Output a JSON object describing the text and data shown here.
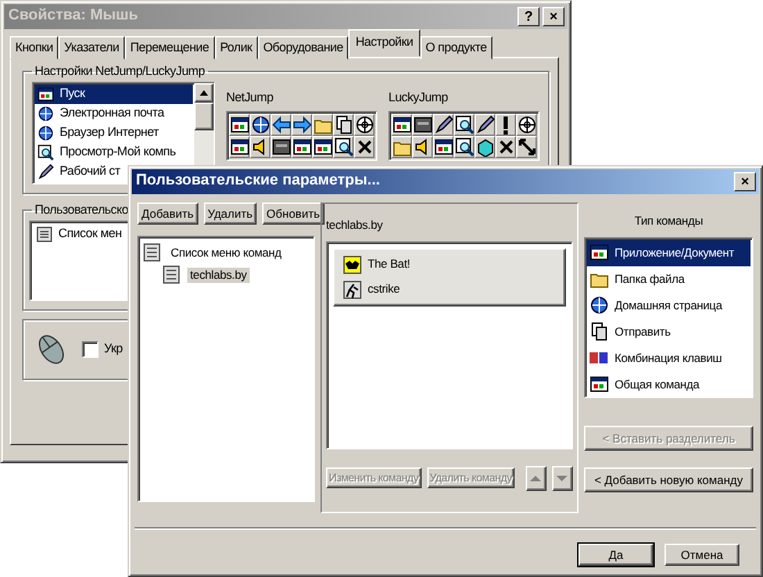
{
  "back_window": {
    "title": "Свойства: Мышь",
    "title_buttons": [
      "?",
      "×"
    ],
    "tabs": [
      {
        "label": "Кнопки",
        "selected": false
      },
      {
        "label": "Указатели",
        "selected": false
      },
      {
        "label": "Перемещение",
        "selected": false
      },
      {
        "label": "Ролик",
        "selected": false
      },
      {
        "label": "Оборудование",
        "selected": false
      },
      {
        "label": "Настройки",
        "selected": true
      },
      {
        "label": "О продукте",
        "selected": false
      }
    ],
    "settings_group": {
      "title": "Настройки NetJump/LuckyJump",
      "items": [
        {
          "label": "Пуск",
          "selected": true
        },
        {
          "label": "Электронная почта",
          "selected": false
        },
        {
          "label": "Браузер Интернет",
          "selected": false
        },
        {
          "label": "Просмотр-Мой компь",
          "selected": false
        },
        {
          "label": "Рабочий ст",
          "selected": false
        }
      ],
      "toolbars": [
        {
          "label": "NetJump"
        },
        {
          "label": "LuckyJump"
        }
      ]
    },
    "custom_group": {
      "title": "Пользовательско",
      "items": [
        {
          "label": "Список мен"
        }
      ]
    },
    "options_group": {
      "checkbox": {
        "label": "Укр",
        "checked": false
      }
    }
  },
  "dialog": {
    "title": "Пользовательские параметры...",
    "close": "×",
    "tree_buttons": [
      {
        "label": "Добавить"
      },
      {
        "label": "Удалить"
      },
      {
        "label": "Обновить"
      }
    ],
    "tree": [
      {
        "label": "Список меню команд",
        "selected": false,
        "children": [
          {
            "label": "techlabs.by",
            "selected": true
          }
        ]
      }
    ],
    "commands": {
      "title": "techlabs.by",
      "items": [
        {
          "label": "The Bat!"
        },
        {
          "label": "cstrike"
        }
      ],
      "buttons": [
        {
          "kind": "text",
          "label": "Изменить команду",
          "disabled": true
        },
        {
          "kind": "text",
          "label": "Удалить команду",
          "disabled": true
        },
        {
          "kind": "up",
          "disabled": true
        },
        {
          "kind": "down",
          "disabled": true
        }
      ]
    },
    "command_types": {
      "title": "Тип команды",
      "items": [
        {
          "label": "Приложение/Документ",
          "selected": true
        },
        {
          "label": "Папка файла",
          "selected": false
        },
        {
          "label": "Домашняя страница",
          "selected": false
        },
        {
          "label": "Отправить",
          "selected": false
        },
        {
          "label": "Комбинация клавиш",
          "selected": false
        },
        {
          "label": "Общая команда",
          "selected": false
        }
      ],
      "buttons": [
        {
          "label": "< Вставить разделитель",
          "disabled": true
        },
        {
          "label": "< Добавить новую команду",
          "disabled": false
        }
      ]
    },
    "footer_buttons": [
      {
        "label": "Да",
        "default": true
      },
      {
        "label": "Отмена",
        "default": false
      }
    ]
  }
}
